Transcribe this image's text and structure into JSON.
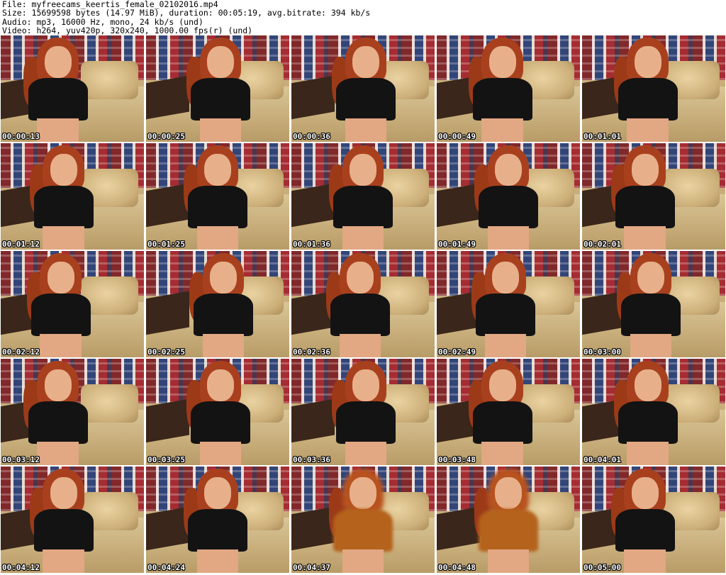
{
  "header": {
    "file_line": "File: myfreecams_keertis_female_02102016.mp4",
    "size_line": "Size: 15699598 bytes (14.97 MiB), duration: 00:05:19, avg.bitrate: 394 kb/s",
    "audio_line": "Audio: mp3, 16000 Hz, mono, 24 kb/s (und)",
    "video_line": "Video: h264, yuv420p, 320x240, 1000.00 fps(r) (und)"
  },
  "thumbnails": [
    {
      "timestamp": "00:00:13"
    },
    {
      "timestamp": "00:00:25"
    },
    {
      "timestamp": "00:00:36"
    },
    {
      "timestamp": "00:00:49"
    },
    {
      "timestamp": "00:01:01"
    },
    {
      "timestamp": "00:01:12"
    },
    {
      "timestamp": "00:01:25"
    },
    {
      "timestamp": "00:01:36"
    },
    {
      "timestamp": "00:01:49"
    },
    {
      "timestamp": "00:02:01"
    },
    {
      "timestamp": "00:02:12"
    },
    {
      "timestamp": "00:02:25"
    },
    {
      "timestamp": "00:02:36"
    },
    {
      "timestamp": "00:02:49"
    },
    {
      "timestamp": "00:03:00"
    },
    {
      "timestamp": "00:03:12"
    },
    {
      "timestamp": "00:03:25"
    },
    {
      "timestamp": "00:03:36"
    },
    {
      "timestamp": "00:03:48"
    },
    {
      "timestamp": "00:04:01"
    },
    {
      "timestamp": "00:04:12"
    },
    {
      "timestamp": "00:04:24"
    },
    {
      "timestamp": "00:04:37"
    },
    {
      "timestamp": "00:04:48"
    },
    {
      "timestamp": "00:05:00"
    }
  ],
  "colors": {
    "background": "#ffffff",
    "header_text": "#000000",
    "timestamp_text": "#ffffff",
    "timestamp_outline": "#000000"
  }
}
